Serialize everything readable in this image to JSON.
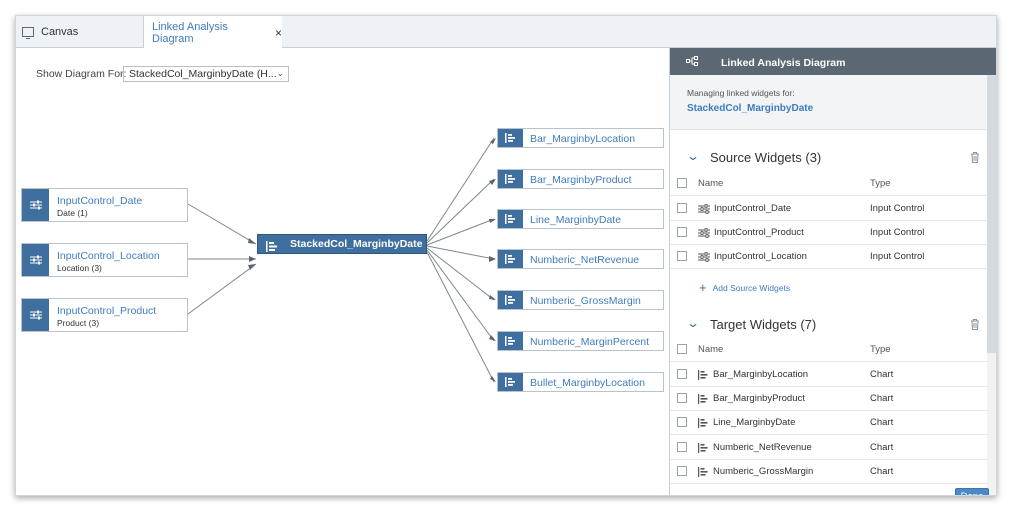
{
  "tabs": [
    {
      "label": "Canvas"
    },
    {
      "label": "Linked Analysis Diagram",
      "close": "×"
    }
  ],
  "toolbar": {
    "show_label": "Show Diagram For:",
    "dropdown_value": "StackedCol_MarginbyDate (H..."
  },
  "diagram": {
    "sources": [
      {
        "title": "InputControl_Date",
        "subtitle": "Date (1)"
      },
      {
        "title": "InputControl_Location",
        "subtitle": "Location (3)"
      },
      {
        "title": "InputControl_Product",
        "subtitle": "Product (3)"
      }
    ],
    "center": "StackedCol_MarginbyDate",
    "targets": [
      "Bar_MarginbyLocation",
      "Bar_MarginbyProduct",
      "Line_MarginbyDate",
      "Numberic_NetRevenue",
      "Numberic_GrossMargin",
      "Numberic_MarginPercent",
      "Bullet_MarginbyLocation"
    ]
  },
  "panel": {
    "title": "Linked Analysis Diagram",
    "managing_label": "Managing linked widgets for:",
    "managing_widget": "StackedCol_MarginbyDate",
    "source_section": {
      "title": "Source Widgets (3)",
      "col_name": "Name",
      "col_type": "Type",
      "rows": [
        {
          "name": "InputControl_Date",
          "type": "Input Control"
        },
        {
          "name": "InputControl_Product",
          "type": "Input Control"
        },
        {
          "name": "InputControl_Location",
          "type": "Input Control"
        }
      ],
      "add_label": "Add Source Widgets"
    },
    "target_section": {
      "title": "Target Widgets (7)",
      "col_name": "Name",
      "col_type": "Type",
      "rows": [
        {
          "name": "Bar_MarginbyLocation",
          "type": "Chart"
        },
        {
          "name": "Bar_MarginbyProduct",
          "type": "Chart"
        },
        {
          "name": "Line_MarginbyDate",
          "type": "Chart"
        },
        {
          "name": "Numberic_NetRevenue",
          "type": "Chart"
        },
        {
          "name": "Numberic_GrossMargin",
          "type": "Chart"
        }
      ]
    },
    "done_label": "Done"
  },
  "colors": {
    "accent": "#3e6f9e",
    "link": "#3f7cbf",
    "panel_header": "#5b6874",
    "done_button": "#4d89c4"
  },
  "icons": {
    "canvas_tab": "monitor-icon",
    "input_control": "sliders-icon",
    "chart": "bar-chart-icon",
    "panel_header": "linked-nodes-icon",
    "delete": "trash-icon",
    "collapse": "chevron-down-icon",
    "add": "plus-icon"
  }
}
